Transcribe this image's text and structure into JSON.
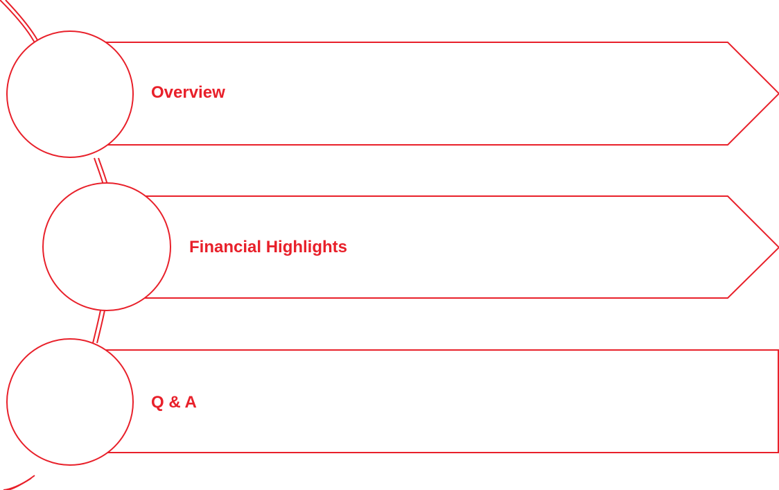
{
  "colors": {
    "accent": "#e8202a",
    "background": "#ffffff"
  },
  "agenda": {
    "items": [
      {
        "label": "Overview",
        "shape": "chevron"
      },
      {
        "label": "Financial Highlights",
        "shape": "chevron"
      },
      {
        "label": "Q & A",
        "shape": "rectangle"
      }
    ]
  }
}
